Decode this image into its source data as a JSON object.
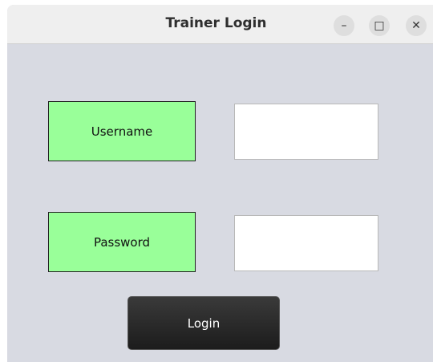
{
  "window": {
    "title": "Trainer Login",
    "controls": {
      "minimize": "–",
      "maximize": "□",
      "close": "✕"
    }
  },
  "form": {
    "username_label": "Username",
    "password_label": "Password",
    "username_value": "",
    "password_value": "",
    "login_label": "Login"
  },
  "colors": {
    "label_bg": "#99ff99",
    "window_bg": "#d8dae2",
    "button_bg": "#2a2a2a"
  }
}
